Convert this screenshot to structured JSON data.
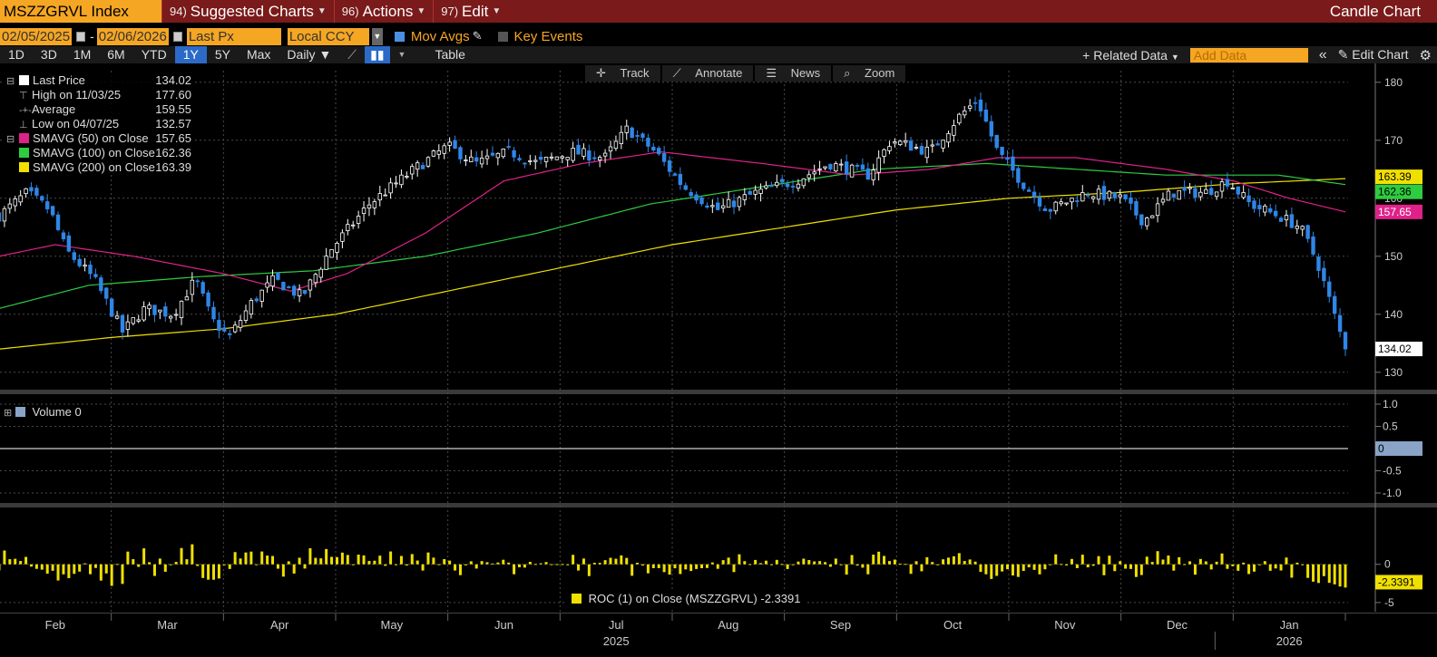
{
  "header": {
    "ticker": "MSZZGRVL Index",
    "menu": [
      {
        "num": "94)",
        "label": "Suggested Charts"
      },
      {
        "num": "96)",
        "label": "Actions"
      },
      {
        "num": "97)",
        "label": "Edit"
      }
    ],
    "title": "Candle Chart"
  },
  "controls": {
    "start_date": "02/05/2025",
    "dash": "-",
    "end_date": "02/06/2026",
    "field": "Last Px",
    "currency": "Local CCY",
    "mov_avgs": "Mov Avgs",
    "key_events": "Key Events"
  },
  "ranges": [
    "1D",
    "3D",
    "1M",
    "6M",
    "YTD",
    "1Y",
    "5Y",
    "Max"
  ],
  "active_range": "1Y",
  "period": "Daily",
  "table_label": "Table",
  "related_data": "+ Related Data",
  "add_data_placeholder": "Add Data",
  "edit_chart": "Edit Chart",
  "tools": [
    "Track",
    "Annotate",
    "News",
    "Zoom"
  ],
  "legend": {
    "last_price": {
      "label": "Last Price",
      "value": "134.02"
    },
    "high": {
      "label": "High on 11/03/25",
      "value": "177.60"
    },
    "average": {
      "label": "Average",
      "value": "159.55"
    },
    "low": {
      "label": "Low on 04/07/25",
      "value": "132.57"
    },
    "sma50": {
      "label": "SMAVG (50)  on Close",
      "value": "157.65",
      "color": "#e0218a"
    },
    "sma100": {
      "label": "SMAVG (100)  on Close",
      "value": "162.36",
      "color": "#2ecc40"
    },
    "sma200": {
      "label": "SMAVG (200)  on Close",
      "value": "163.39",
      "color": "#f0e000"
    }
  },
  "volume_legend": "Volume 0",
  "roc_legend": "ROC (1)  on Close (MSZZGRVL) -2.3391",
  "colors": {
    "up": "#ffffff",
    "down": "#2f86e6",
    "sma50": "#e0218a",
    "sma100": "#2ecc40",
    "sma200": "#f0e000",
    "roc": "#f0e000",
    "accent": "#f5a623"
  },
  "chart_data": {
    "type": "candlestick",
    "x_months": [
      "Feb",
      "Mar",
      "Apr",
      "May",
      "Jun",
      "Jul",
      "Aug",
      "Sep",
      "Oct",
      "Nov",
      "Dec",
      "Jan"
    ],
    "x_years": [
      "2025",
      "2026"
    ],
    "price_axis": {
      "ticks": [
        130,
        140,
        150,
        160,
        170,
        180
      ],
      "range": [
        127,
        182
      ]
    },
    "volume_axis": {
      "ticks": [
        "1.0",
        "0.5",
        "0",
        "-0.5",
        "-1.0"
      ]
    },
    "roc_axis": {
      "ticks": [
        "0",
        "-5"
      ],
      "range": [
        -6.2,
        7.2
      ]
    },
    "price_anchors": [
      {
        "m": 0.0,
        "v": 157
      },
      {
        "m": 0.25,
        "v": 161
      },
      {
        "m": 0.45,
        "v": 158
      },
      {
        "m": 0.6,
        "v": 151
      },
      {
        "m": 0.85,
        "v": 146
      },
      {
        "m": 1.1,
        "v": 137
      },
      {
        "m": 1.3,
        "v": 141
      },
      {
        "m": 1.55,
        "v": 140
      },
      {
        "m": 1.75,
        "v": 146
      },
      {
        "m": 1.9,
        "v": 139
      },
      {
        "m": 2.05,
        "v": 136
      },
      {
        "m": 2.25,
        "v": 142
      },
      {
        "m": 2.45,
        "v": 146
      },
      {
        "m": 2.7,
        "v": 143
      },
      {
        "m": 2.95,
        "v": 151
      },
      {
        "m": 3.3,
        "v": 159
      },
      {
        "m": 3.7,
        "v": 165
      },
      {
        "m": 4.0,
        "v": 169
      },
      {
        "m": 4.25,
        "v": 166
      },
      {
        "m": 4.55,
        "v": 168
      },
      {
        "m": 4.8,
        "v": 166
      },
      {
        "m": 5.1,
        "v": 168
      },
      {
        "m": 5.4,
        "v": 167
      },
      {
        "m": 5.6,
        "v": 172
      },
      {
        "m": 5.85,
        "v": 168
      },
      {
        "m": 6.1,
        "v": 162
      },
      {
        "m": 6.4,
        "v": 158
      },
      {
        "m": 6.75,
        "v": 161
      },
      {
        "m": 7.1,
        "v": 163
      },
      {
        "m": 7.4,
        "v": 166
      },
      {
        "m": 7.75,
        "v": 164
      },
      {
        "m": 7.95,
        "v": 170
      },
      {
        "m": 8.3,
        "v": 168
      },
      {
        "m": 8.55,
        "v": 174
      },
      {
        "m": 8.72,
        "v": 177
      },
      {
        "m": 8.9,
        "v": 168
      },
      {
        "m": 9.15,
        "v": 162
      },
      {
        "m": 9.35,
        "v": 158
      },
      {
        "m": 9.7,
        "v": 161
      },
      {
        "m": 10.0,
        "v": 160
      },
      {
        "m": 10.2,
        "v": 156
      },
      {
        "m": 10.45,
        "v": 161
      },
      {
        "m": 10.75,
        "v": 161
      },
      {
        "m": 10.95,
        "v": 163
      },
      {
        "m": 11.15,
        "v": 159
      },
      {
        "m": 11.4,
        "v": 157
      },
      {
        "m": 11.6,
        "v": 155
      },
      {
        "m": 11.75,
        "v": 149
      },
      {
        "m": 11.9,
        "v": 140
      },
      {
        "m": 12.0,
        "v": 134
      }
    ],
    "sma50_anchors": [
      {
        "m": 0.0,
        "v": 150
      },
      {
        "m": 0.5,
        "v": 152
      },
      {
        "m": 1.2,
        "v": 150
      },
      {
        "m": 2.0,
        "v": 147
      },
      {
        "m": 2.6,
        "v": 144
      },
      {
        "m": 3.1,
        "v": 147
      },
      {
        "m": 3.8,
        "v": 154
      },
      {
        "m": 4.5,
        "v": 163
      },
      {
        "m": 5.2,
        "v": 166
      },
      {
        "m": 5.9,
        "v": 168
      },
      {
        "m": 6.8,
        "v": 166
      },
      {
        "m": 7.6,
        "v": 164
      },
      {
        "m": 8.3,
        "v": 165
      },
      {
        "m": 8.9,
        "v": 167
      },
      {
        "m": 9.6,
        "v": 167
      },
      {
        "m": 10.4,
        "v": 165
      },
      {
        "m": 11.0,
        "v": 163
      },
      {
        "m": 11.5,
        "v": 160
      },
      {
        "m": 12.0,
        "v": 157.65
      }
    ],
    "sma100_anchors": [
      {
        "m": 0.0,
        "v": 141
      },
      {
        "m": 0.8,
        "v": 145
      },
      {
        "m": 1.8,
        "v": 146.5
      },
      {
        "m": 2.8,
        "v": 147.5
      },
      {
        "m": 3.8,
        "v": 150
      },
      {
        "m": 4.8,
        "v": 154
      },
      {
        "m": 5.8,
        "v": 159
      },
      {
        "m": 6.8,
        "v": 162
      },
      {
        "m": 7.8,
        "v": 165
      },
      {
        "m": 8.8,
        "v": 166
      },
      {
        "m": 9.6,
        "v": 165
      },
      {
        "m": 10.4,
        "v": 164
      },
      {
        "m": 11.4,
        "v": 164
      },
      {
        "m": 12.0,
        "v": 162.36
      }
    ],
    "sma200_anchors": [
      {
        "m": 0.0,
        "v": 134
      },
      {
        "m": 1.0,
        "v": 136
      },
      {
        "m": 2.0,
        "v": 137.5
      },
      {
        "m": 3.0,
        "v": 140
      },
      {
        "m": 4.0,
        "v": 144
      },
      {
        "m": 5.0,
        "v": 148
      },
      {
        "m": 6.0,
        "v": 152
      },
      {
        "m": 7.0,
        "v": 155
      },
      {
        "m": 8.0,
        "v": 158
      },
      {
        "m": 9.0,
        "v": 160
      },
      {
        "m": 10.0,
        "v": 161
      },
      {
        "m": 11.0,
        "v": 162.5
      },
      {
        "m": 12.0,
        "v": 163.39
      }
    ],
    "last_values": {
      "price": "134.02",
      "sma50": "157.65",
      "sma100": "162.36",
      "sma200": "163.39",
      "volume": "0",
      "roc": "-2.3391"
    }
  }
}
